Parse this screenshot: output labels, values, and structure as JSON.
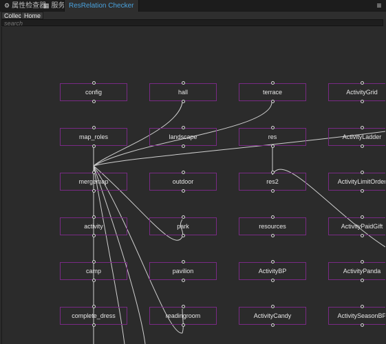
{
  "tabs": [
    {
      "icon": "gear-icon",
      "label": "属性检查器"
    },
    {
      "icon": "grid-icon",
      "label": "服务"
    },
    {
      "label": "ResRelation Checker"
    }
  ],
  "menu_icon": "hamburger-menu-icon",
  "toolbar": {
    "collect_label": "Collect",
    "home_label": "Home"
  },
  "search": {
    "placeholder": "search"
  },
  "nodes": [
    "config",
    "hall",
    "terrace",
    "ActivityGrid",
    "map_roles",
    "landscape",
    "res",
    "ActivityLadder",
    "mergemap",
    "outdoor",
    "res2",
    "ActivityLimitOrder",
    "activity",
    "park",
    "resources",
    "ActivityPaidGift",
    "camp",
    "pavilion",
    "ActivityBP",
    "ActivityPanda",
    "complete_dress",
    "readingroom",
    "ActivityCandy",
    "ActivitySeasonBP"
  ],
  "colors": {
    "node_border": "#7a2a86",
    "active_tab": "#4aa3df",
    "edge": "#d0d0d0"
  }
}
